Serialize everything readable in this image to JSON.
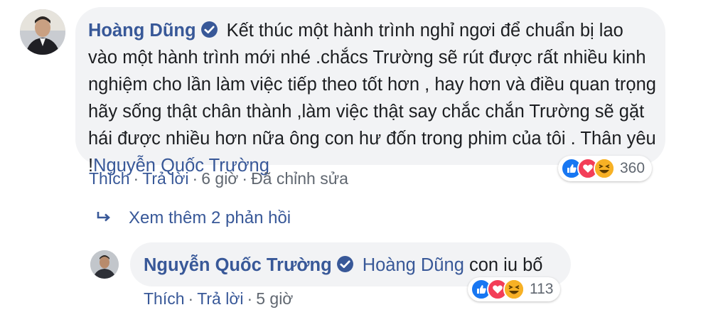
{
  "comment": {
    "author": "Hoàng Dũng",
    "text": "Kết thúc một hành trình nghỉ ngơi để chuẩn bị lao vào một hành trình mới nhé .chắcs Trường sẽ rút được rất nhiều kinh nghiệm cho lần làm việc tiếp theo tốt hơn , hay hơn và điều quan trọng hãy sống thật chân thành ,làm việc thật say chắc chắn Trường sẽ gặt hái được nhiều hơn nữa ông con hư đốn trong phim của tôi . Thân yêu !",
    "mention": "Nguyễn Quốc Trường",
    "actions": {
      "like": "Thích",
      "reply": "Trả lời",
      "time": "6 giờ",
      "edited": "Đã chỉnh sửa"
    },
    "reactions": {
      "types": [
        "like-icon",
        "love-icon",
        "haha-icon"
      ],
      "count": "360"
    }
  },
  "view_more": {
    "label": "Xem thêm 2 phản hồi"
  },
  "reply": {
    "author": "Nguyễn Quốc Trường",
    "mention": "Hoàng Dũng",
    "text": "con iu bố",
    "actions": {
      "like": "Thích",
      "reply": "Trả lời",
      "time": "5 giờ"
    },
    "reactions": {
      "types": [
        "like-icon",
        "love-icon",
        "haha-icon"
      ],
      "count": "113"
    }
  },
  "colors": {
    "link": "#385898",
    "bubble": "#f2f3f5",
    "meta": "#606770",
    "like": "#1877f2",
    "love": "#f33e58",
    "haha": "#f7b125"
  }
}
